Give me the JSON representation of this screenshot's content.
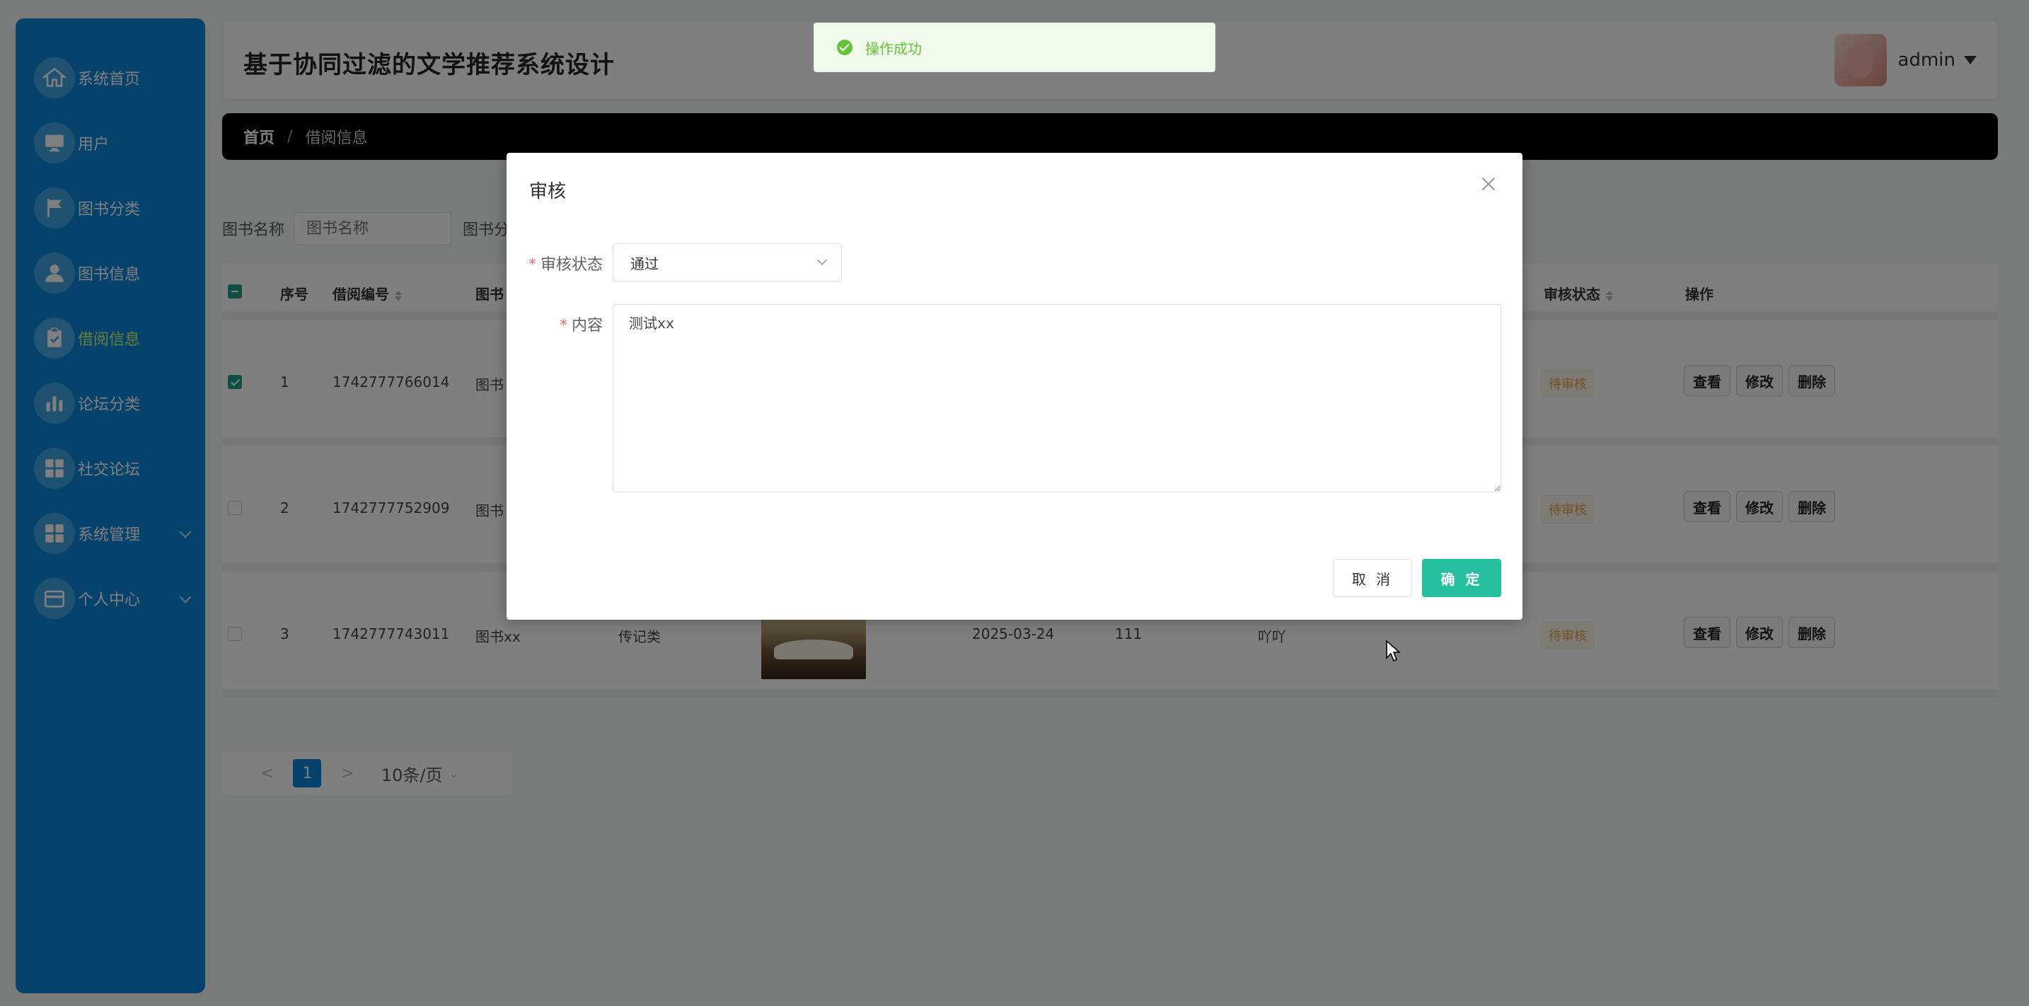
{
  "app": {
    "title": "基于协同过滤的文学推荐系统设计",
    "user": "admin"
  },
  "sidebar": {
    "items": [
      {
        "label": "系统首页",
        "icon": "home-icon"
      },
      {
        "label": "用户",
        "icon": "monitor-icon"
      },
      {
        "label": "图书分类",
        "icon": "flag-icon"
      },
      {
        "label": "图书信息",
        "icon": "user-icon"
      },
      {
        "label": "借阅信息",
        "icon": "clipboard-icon",
        "active": true
      },
      {
        "label": "论坛分类",
        "icon": "bar-chart-icon"
      },
      {
        "label": "社交论坛",
        "icon": "grid-icon"
      },
      {
        "label": "系统管理",
        "icon": "grid-icon",
        "expandable": true
      },
      {
        "label": "个人中心",
        "icon": "wallet-icon",
        "expandable": true
      }
    ],
    "active_color": "#d6ff74",
    "bg_color": "#0b85d8"
  },
  "breadcrumb": {
    "home": "首页",
    "sep": "/",
    "current": "借阅信息"
  },
  "search": {
    "label1": "图书名称",
    "placeholder1": "图书名称",
    "label2": "图书分"
  },
  "table": {
    "headers": {
      "index": "序号",
      "borrow_no": "借阅编号",
      "book": "图书",
      "status": "审核状态",
      "actions": "操作"
    },
    "rows": [
      {
        "index": "1",
        "borrow_no": "1742777766014",
        "book": "图书",
        "status": "待审核",
        "checked": true
      },
      {
        "index": "2",
        "borrow_no": "1742777752909",
        "book": "图书",
        "status": "待审核",
        "checked": false
      },
      {
        "index": "3",
        "borrow_no": "1742777743011",
        "book": "图书xx",
        "category": "传记类",
        "date": "2025-03-24",
        "qty": "111",
        "remark": "吖吖",
        "status": "待审核",
        "checked": false
      }
    ],
    "buttons": {
      "view": "查看",
      "edit": "修改",
      "delete": "删除"
    }
  },
  "pager": {
    "prev": "<",
    "page": "1",
    "next": ">",
    "size": "10条/页",
    "size_caret": "⌄"
  },
  "toast": {
    "text": "操作成功"
  },
  "dialog": {
    "title": "审核",
    "status_label": "审核状态",
    "status_value": "通过",
    "content_label": "内容",
    "content_value": "测试xx",
    "required_mark": "*",
    "cancel": "取 消",
    "ok": "确 定",
    "ok_color": "#26bfa0"
  }
}
